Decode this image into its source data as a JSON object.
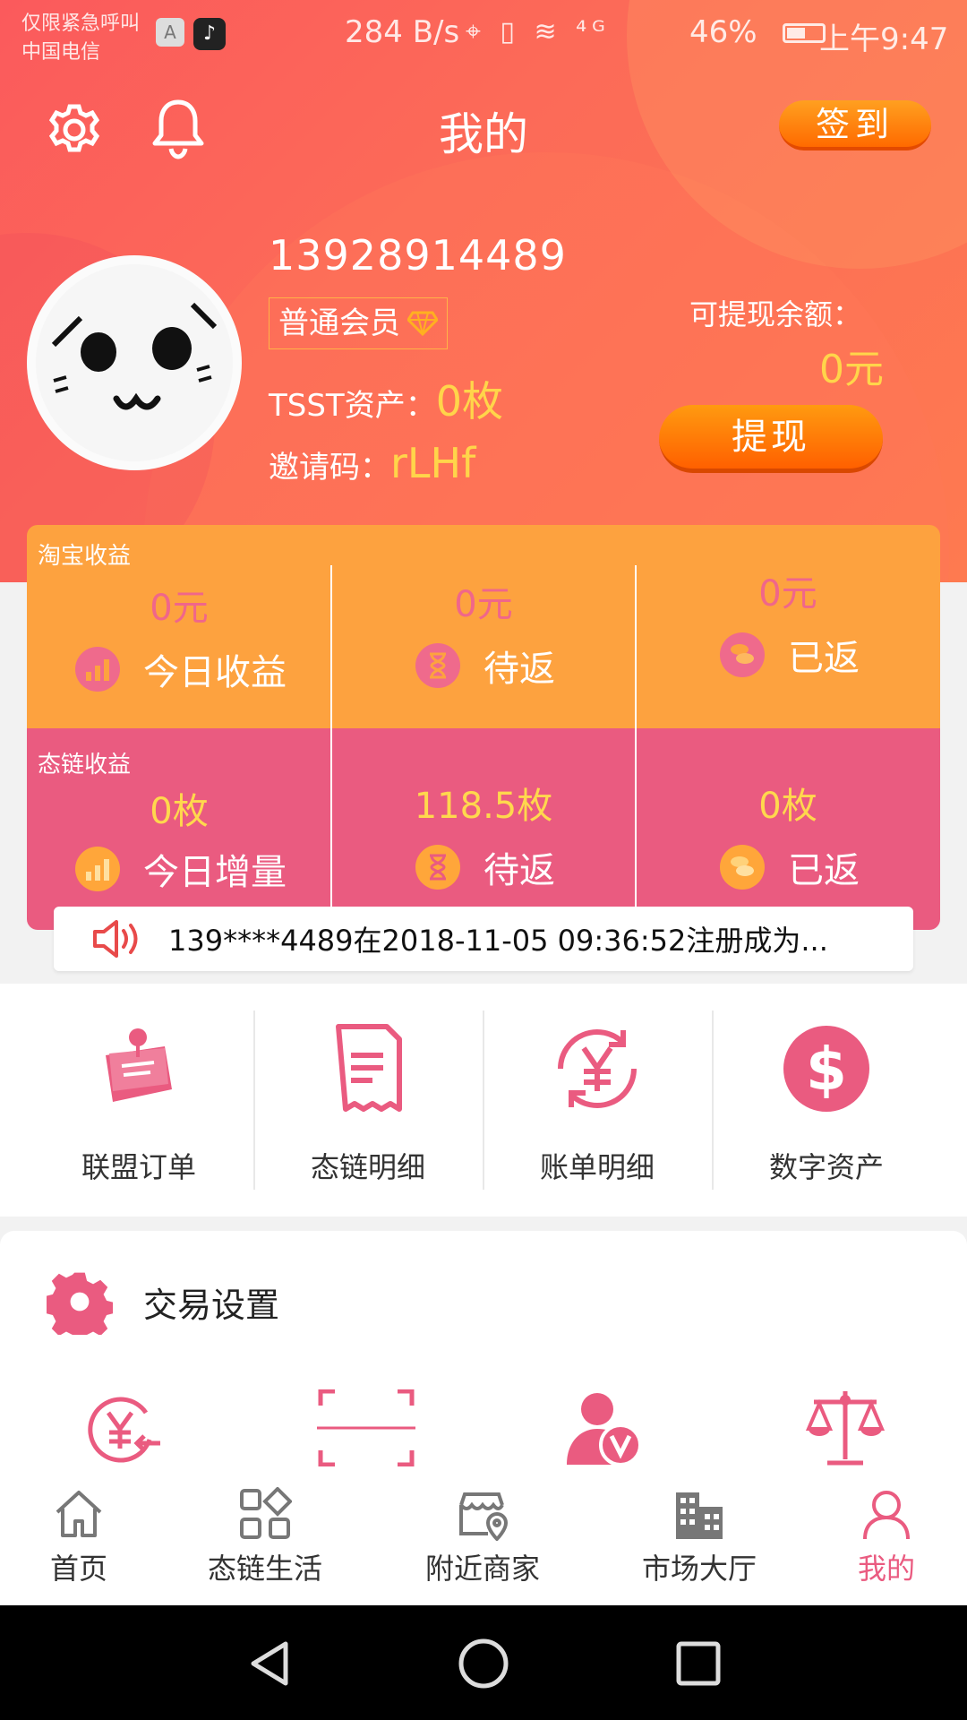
{
  "status_bar": {
    "carrier_line1": "仅限紧急呼叫",
    "carrier_line2": "中国电信",
    "app_badge_a": "A",
    "app_badge_tiktok": "♪",
    "speed": "284 B/s",
    "indicators": "⌖ ▯ ≋ ⁴ᴳ",
    "battery": "46%",
    "time": "上午9:47"
  },
  "header": {
    "title": "我的",
    "signin_label": "签到"
  },
  "profile": {
    "phone": "13928914489",
    "member_level": "普通会员",
    "tsst_label": "TSST资产：",
    "tsst_value": "0枚",
    "invite_label": "邀请码：",
    "invite_value": "rLHf",
    "withdrawable_label": "可提现余额：",
    "withdrawable_value": "0元",
    "withdraw_button": "提现"
  },
  "earnings": {
    "taobao": {
      "title": "淘宝收益",
      "cells": [
        {
          "amount": "0元",
          "label": "今日收益",
          "icon": "bar-chart-icon"
        },
        {
          "amount": "0元",
          "label": "待返",
          "icon": "hourglass-icon"
        },
        {
          "amount": "0元",
          "label": "已返",
          "icon": "coins-icon"
        }
      ]
    },
    "chain": {
      "title": "态链收益",
      "cells": [
        {
          "amount": "0枚",
          "label": "今日增量",
          "icon": "bar-chart-icon"
        },
        {
          "amount": "118.5枚",
          "label": "待返",
          "icon": "hourglass-icon"
        },
        {
          "amount": "0枚",
          "label": "已返",
          "icon": "coins-icon"
        }
      ]
    }
  },
  "marquee": {
    "text": "139****4489在2018-11-05 09:36:52注册成为..."
  },
  "quick_menu": [
    {
      "label": "联盟订单",
      "icon": "note-pin-icon"
    },
    {
      "label": "态链明细",
      "icon": "receipt-icon"
    },
    {
      "label": "账单明细",
      "icon": "yen-refresh-icon"
    },
    {
      "label": "数字资产",
      "icon": "dollar-circle-icon"
    }
  ],
  "trade_settings": {
    "title": "交易设置",
    "icons": [
      "yen-return-icon",
      "scan-icon",
      "user-verified-icon",
      "scale-icon"
    ]
  },
  "tabbar": [
    {
      "label": "首页",
      "icon": "home-icon"
    },
    {
      "label": "态链生活",
      "icon": "grid-icon"
    },
    {
      "label": "附近商家",
      "icon": "store-location-icon"
    },
    {
      "label": "市场大厅",
      "icon": "buildings-icon"
    },
    {
      "label": "我的",
      "icon": "person-icon",
      "active": true
    }
  ],
  "colors": {
    "header_gradient_start": "#fb5a5c",
    "header_gradient_end": "#fe7a50",
    "taobao_row": "#fda23f",
    "chain_row": "#ea5b80",
    "accent_yellow": "#ffd54a",
    "accent_pink": "#ea5b80"
  }
}
